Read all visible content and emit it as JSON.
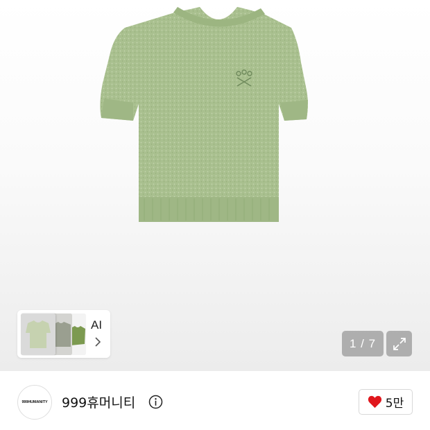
{
  "gallery": {
    "counter_text": "1 / 7",
    "current_index": 1,
    "total_images": 7,
    "product_color": "#a8bf8e"
  },
  "ai_card": {
    "label": "AI"
  },
  "brand": {
    "logo_text": "999HUMANITY",
    "name": "999휴머니티"
  },
  "like": {
    "count": "5만",
    "heart_color": "#e0171d"
  }
}
